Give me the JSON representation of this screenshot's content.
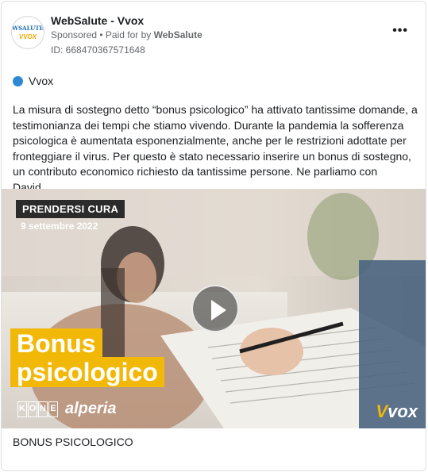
{
  "header": {
    "page_name": "WebSalute - Vvox",
    "sponsored": "Sponsored",
    "paid_for_prefix": "• Paid for by",
    "payer": "WebSalute",
    "ad_id": "ID: 668470367571648",
    "avatar_top": "WSALUTE",
    "avatar_bottom": "VVOX"
  },
  "platform": {
    "label": "Vvox",
    "icon": "blue-dot-icon",
    "color": "#2e88d4"
  },
  "body_text": "La misura di sostegno detto “bonus psicologico” ha attivato tantissime domande, a testimonianza dei tempi che stiamo vivendo. Durante la pandemia la sofferenza psicologica è aumentata esponenzialmente, anche per le restrizioni adottate per fronteggiare il virus. Per questo è stato necessario inserire un bonus di sostegno, un contributo economico richiesto da tantissime persone. Ne parliamo con David…",
  "media": {
    "category": "PRENDERSI CURA",
    "date": "9 settembre 2022",
    "headline_line1": "Bonus",
    "headline_line2": "psicologico",
    "brand_kone": [
      "K",
      "O",
      "N",
      "E"
    ],
    "brand_alperia": "alperia",
    "brand_vvox_v": "V",
    "brand_vvox_rest": "vox",
    "accent_color": "#f2b807"
  },
  "caption": "BONUS PSICOLOGICO"
}
